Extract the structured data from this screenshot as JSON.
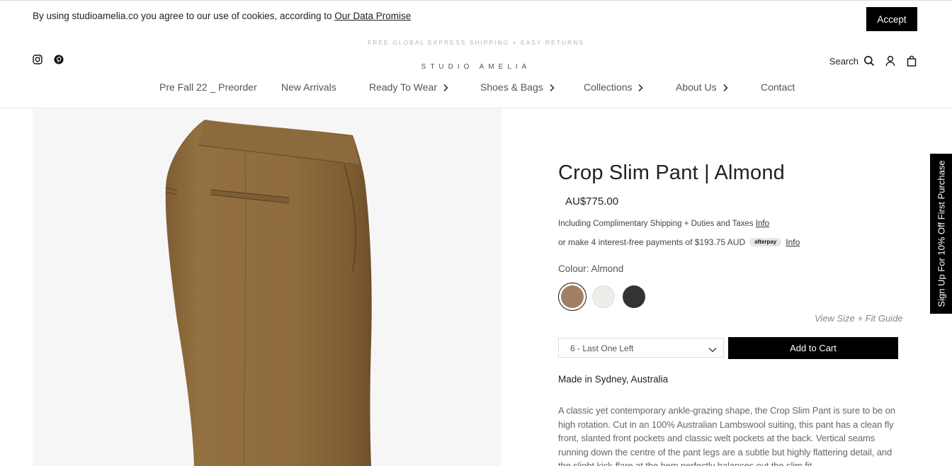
{
  "cookie_bar": {
    "text": "By using studioamelia.co you agree to our use of cookies, according to ",
    "link": "Our Data Promise",
    "accept_label": "Accept"
  },
  "header": {
    "shipping_banner": "FREE GLOBAL EXPRESS SHIPPING + EASY RETURNS",
    "logo": "STUDIO AMELIA",
    "social_icons": [
      "instagram-icon",
      "pinterest-icon"
    ],
    "search_label": "Search",
    "icons": [
      "search-icon",
      "account-icon",
      "cart-icon"
    ]
  },
  "nav": {
    "items": [
      {
        "label": "Pre Fall 22 _ Preorder",
        "has_submenu": false
      },
      {
        "label": "New Arrivals",
        "has_submenu": false
      },
      {
        "label": "Ready To Wear",
        "has_submenu": true
      },
      {
        "label": "Shoes & Bags",
        "has_submenu": true
      },
      {
        "label": "Collections",
        "has_submenu": true
      },
      {
        "label": "About Us",
        "has_submenu": true
      },
      {
        "label": "Contact",
        "has_submenu": false
      }
    ]
  },
  "product": {
    "title": "Crop Slim Pant | Almond",
    "price": "AU$775.00",
    "shipping_note": "Including Complimentary Shipping + Duties and Taxes",
    "shipping_info_link": "Info",
    "afterpay_text": "or make 4 interest-free payments of $193.75 AUD",
    "afterpay_badge": "afterpay",
    "afterpay_info_link": "Info",
    "colour_label": "Colour: Almond",
    "swatches": [
      {
        "name": "Almond",
        "color": "#a27f63",
        "selected": true
      },
      {
        "name": "Cream",
        "color": "#efede8",
        "selected": false
      },
      {
        "name": "Charcoal",
        "color": "#333333",
        "selected": false
      }
    ],
    "size_guide": "View Size + Fit Guide",
    "size_selected": "6 - Last One Left",
    "add_to_cart": "Add to Cart",
    "made_in": "Made in Sydney, Australia",
    "description": "A classic yet contemporary ankle-grazing shape, the Crop Slim Pant is sure to be on high rotation. Cut in an 100% Australian Lambswool suiting, this pant has a clean fly front, slanted front pockets and classic welt pockets at the back. Vertical seams running down the centre of the pant legs are a subtle but highly flattering detail, and the slight kick-flare at the hem perfectly balances out the slim fit."
  },
  "signup_tab": "Sign Up For 10% Off First Purchase",
  "colors": {
    "accent": "#000000",
    "pant": "#8e6a3d",
    "image_bg": "#f7f6f7"
  }
}
